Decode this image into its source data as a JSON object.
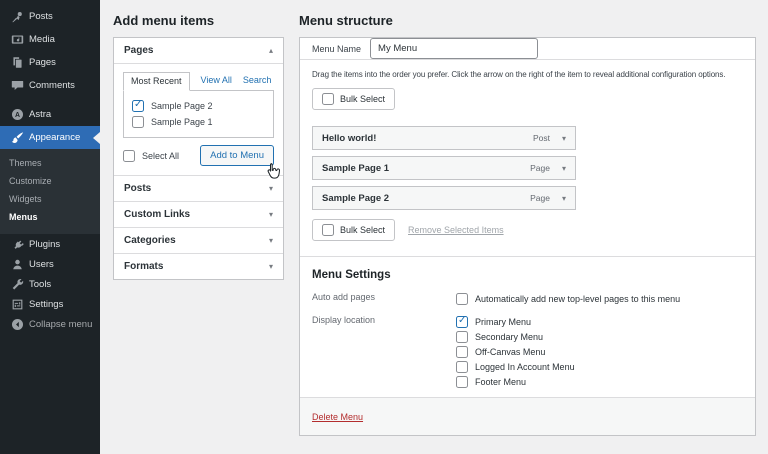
{
  "colors": {
    "page_bg": "#f0f0f1",
    "sidebar_bg": "#1d2327",
    "submenu_bg": "#2a3136",
    "active_menu_blue": "#2e6cb5",
    "accent_blue": "#2271b1",
    "row_bg": "#f6f7f7",
    "border": "#c3c4c7",
    "muted_text": "#646970",
    "delete_red": "#b32d2e"
  },
  "icons": {
    "chevron_down": "▾",
    "chevron_up": "▴",
    "checkmark": "✓"
  },
  "sidebar": {
    "items": [
      {
        "label": "Posts",
        "icon": "pin"
      },
      {
        "label": "Media",
        "icon": "media"
      },
      {
        "label": "Pages",
        "icon": "pages"
      },
      {
        "label": "Comments",
        "icon": "comments"
      },
      {
        "label": "Astra",
        "icon": "astra",
        "gap_before": true
      },
      {
        "label": "Appearance",
        "icon": "brush",
        "active": true
      },
      {
        "label": "Plugins",
        "icon": "plugin",
        "compact": true
      },
      {
        "label": "Users",
        "icon": "user",
        "compact": true
      },
      {
        "label": "Tools",
        "icon": "wrench",
        "compact": true
      },
      {
        "label": "Settings",
        "icon": "settings",
        "compact": true
      },
      {
        "label": "Collapse menu",
        "icon": "collapse",
        "compact": true,
        "muted": true
      }
    ],
    "submenu": [
      {
        "label": "Themes"
      },
      {
        "label": "Customize"
      },
      {
        "label": "Widgets"
      },
      {
        "label": "Menus",
        "current": true
      }
    ]
  },
  "add_panel": {
    "title": "Add menu items",
    "pages": {
      "label": "Pages",
      "tabs": [
        "Most Recent",
        "View All",
        "Search"
      ],
      "items": [
        {
          "label": "Sample Page 2",
          "checked": true
        },
        {
          "label": "Sample Page 1",
          "checked": false
        }
      ],
      "select_all": "Select All",
      "add_button": "Add to Menu"
    },
    "collapsed_sections": [
      "Posts",
      "Custom Links",
      "Categories",
      "Formats"
    ]
  },
  "structure": {
    "title": "Menu structure",
    "menu_name_label": "Menu Name",
    "menu_name_value": "My Menu",
    "drag_hint": "Drag the items into the order you prefer. Click the arrow on the right of the item to reveal additional configuration options.",
    "bulk_select": "Bulk Select",
    "items": [
      {
        "title": "Hello world!",
        "type": "Post"
      },
      {
        "title": "Sample Page 1",
        "type": "Page"
      },
      {
        "title": "Sample Page 2",
        "type": "Page"
      }
    ],
    "remove_link": "Remove Selected Items",
    "settings": {
      "title": "Menu Settings",
      "auto_add_label": "Auto add pages",
      "auto_add_option": {
        "label": "Automatically add new top-level pages to this menu",
        "checked": false
      },
      "display_label": "Display location",
      "locations": [
        {
          "label": "Primary Menu",
          "checked": true
        },
        {
          "label": "Secondary Menu",
          "checked": false
        },
        {
          "label": "Off-Canvas Menu",
          "checked": false
        },
        {
          "label": "Logged In Account Menu",
          "checked": false
        },
        {
          "label": "Footer Menu",
          "checked": false
        }
      ]
    },
    "delete_link": "Delete Menu"
  }
}
